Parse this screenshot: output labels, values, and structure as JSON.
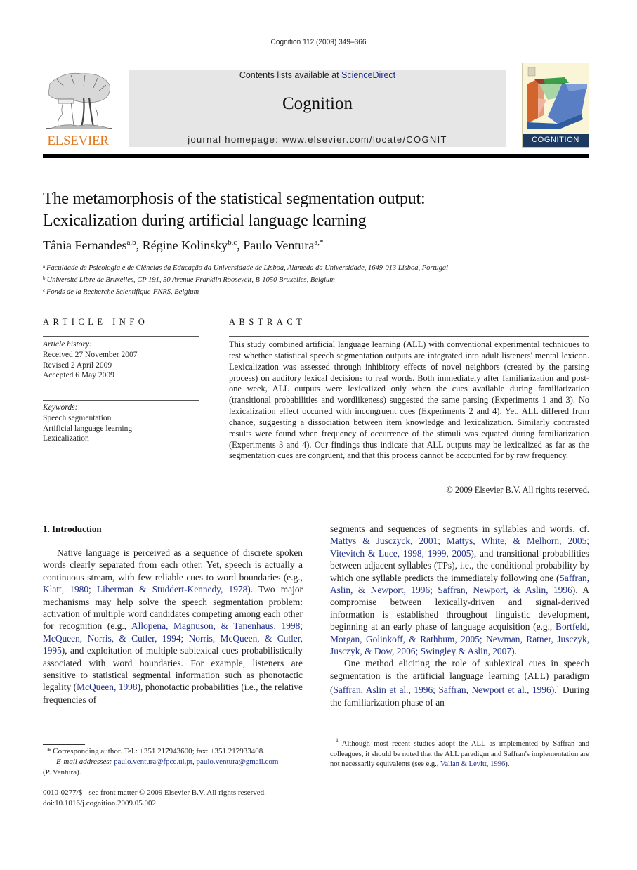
{
  "running_head": "Cognition 112 (2009) 349–366",
  "masthead": {
    "publisher_logo_label": "ELSEVIER",
    "contents_prefix": "Contents lists available at ",
    "contents_link": "ScienceDirect",
    "journal_title": "Cognition",
    "homepage": "journal homepage: www.elsevier.com/locate/COGNIT",
    "cover_label": "COGNITION",
    "colors": {
      "publisher_orange": "#e47a20",
      "banner_gray": "#e6e6e6",
      "link_blue": "#1f2f8a"
    }
  },
  "article": {
    "title_line1": "The metamorphosis of the statistical segmentation output:",
    "title_line2": "Lexicalization during artificial language learning",
    "authors": [
      {
        "name": "Tânia Fernandes",
        "sup": "a,b",
        "sep": ", "
      },
      {
        "name": "Régine Kolinsky",
        "sup": "b,c",
        "sep": ", "
      },
      {
        "name": "Paulo Ventura",
        "sup": "a,*",
        "sep": ""
      }
    ],
    "affiliations": [
      {
        "key": "a",
        "text": "Faculdade de Psicologia e de Ciências da Educação da Universidade de Lisboa, Alameda da Universidade, 1649-013 Lisboa, Portugal"
      },
      {
        "key": "b",
        "text": "Université Libre de Bruxelles, CP 191, 50 Avenue Franklin Roosevelt, B-1050 Bruxelles, Belgium"
      },
      {
        "key": "c",
        "text": "Fonds de la Recherche Scientifique-FNRS, Belgium"
      }
    ]
  },
  "article_info": {
    "heading": "ARTICLE INFO",
    "history_label": "Article history:",
    "history": [
      "Received 27 November 2007",
      "Revised 2 April 2009",
      "Accepted 6 May 2009"
    ],
    "keywords_label": "Keywords:",
    "keywords": [
      "Speech segmentation",
      "Artificial language learning",
      "Lexicalization"
    ]
  },
  "abstract": {
    "heading": "ABSTRACT",
    "text": "This study combined artificial language learning (ALL) with conventional experimental techniques to test whether statistical speech segmentation outputs are integrated into adult listeners' mental lexicon. Lexicalization was assessed through inhibitory effects of novel neighbors (created by the parsing process) on auditory lexical decisions to real words. Both immediately after familiarization and post-one week, ALL outputs were lexi­calized only when the cues available during familiarization (transitional probabilities and wordlikeness) suggested the same parsing (Experiments 1 and 3). No lexicalization effect occurred with incongruent cues (Experiments 2 and 4). Yet, ALL differed from chance, suggesting a dissociation between item knowledge and lexicalization. Similarly contrasted results were found when frequency of occurrence of the stimuli was equated during famil­iarization (Experiments 3 and 4). Our findings thus indicate that ALL outputs may be lex­icalized as far as the segmentation cues are congruent, and that this process cannot be accounted for by raw frequency.",
    "copyright": "© 2009 Elsevier B.V. All rights reserved."
  },
  "body": {
    "section_heading": "1.  Introduction",
    "left_paragraph": [
      {
        "t": "Native language is perceived as a sequence of discrete spoken words clearly separated from each other. Yet, speech is actually a continuous stream, with few reliable cues to word boundaries (e.g., "
      },
      {
        "link": "Klatt, 1980; Liberman & Studdert-Kennedy, 1978"
      },
      {
        "t": "). Two major mechanisms may help solve the speech segmentation problem: activation of multiple word candidates competing among each other for recognition (e.g., "
      },
      {
        "link": "Allopena, Magnuson, & Tanenhaus, 1998; McQueen, Norris, & Cutler, 1994; Norris, McQueen, & Cutler, 1995"
      },
      {
        "t": "), and exploitation of multiple sublexical cues probabilistically associated with word boundaries. For example, listeners are sensitive to statistical segmental information such as phonotactic legality ("
      },
      {
        "link": "McQueen, 1998"
      },
      {
        "t": "), phonotactic probabilities (i.e., the relative frequencies of"
      }
    ],
    "right_paragraph_1": [
      {
        "t": "segments and sequences of segments in syllables and words, cf. "
      },
      {
        "link": "Mattys & Jusczyck, 2001; Mattys, White, & Mel­horn, 2005; Vitevitch & Luce, 1998, 1999, 2005"
      },
      {
        "t": "), and tran­sitional probabilities between adjacent syllables (TPs), i.e., the conditional probability by which one syllable predicts the immediately following one ("
      },
      {
        "link": "Saffran, Aslin, & Newport, 1996; Saffran, Newport, & Aslin, 1996"
      },
      {
        "t": "). A compromise be­tween lexically-driven and signal-derived information is established throughout linguistic development, beginning at an early phase of language acquisition (e.g., "
      },
      {
        "link": "Bortfeld, Morgan, Golinkoff, & Rathbum, 2005; Newman, Ratner, Jusczyk, Jusczyk, & Dow, 2006; Swingley & Aslin, 2007"
      },
      {
        "t": ")."
      }
    ],
    "right_paragraph_2": [
      {
        "t": "One method eliciting the role of sublexical cues in speech segmentation is the artificial language learning (ALL) paradigm ("
      },
      {
        "link": "Saffran, Aslin et al., 1996; Saffran, New­port et al., 1996"
      },
      {
        "t": ")."
      },
      {
        "sup": "1"
      },
      {
        "t": " During the familiarization phase of an"
      }
    ]
  },
  "footnotes": {
    "corresponding_star": "*",
    "corresponding_text": " Corresponding author. Tel.: +351 217943600; fax: +351 217933408.",
    "email_label": "E-mail addresses:",
    "email_1": "paulo.ventura@fpce.ul.pt",
    "email_sep": ", ",
    "email_2": "paulo.ventura@gmail.com",
    "email_owner": "(P. Ventura).",
    "issn_line": "0010-0277/$ - see front matter © 2009 Elsevier B.V. All rights reserved.",
    "doi_line": "doi:10.1016/j.cognition.2009.05.002",
    "fn1_number": "1",
    "fn1_text": " Although most recent studies adopt the ALL as implemented by Saffran and colleagues, it should be noted that the ALL paradigm and Saffran's implementation are not necessarily equivalents (see e.g., ",
    "fn1_link": "Valian & Levitt, 1996",
    "fn1_end": ")."
  }
}
